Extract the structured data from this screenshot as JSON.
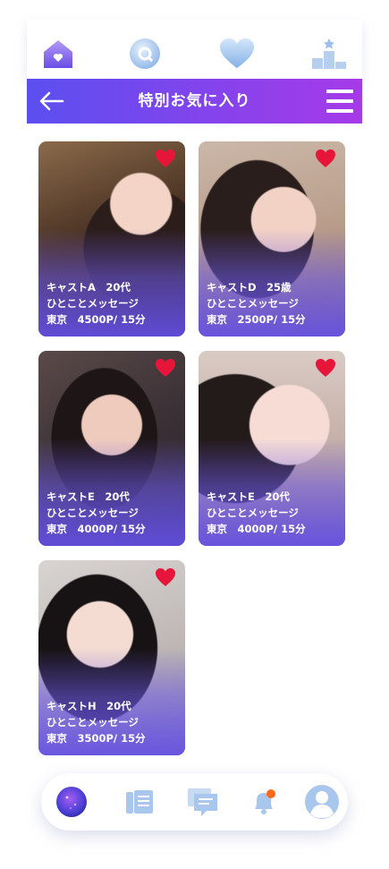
{
  "topnav": {
    "items": [
      {
        "icon": "home-icon"
      },
      {
        "icon": "search-icon"
      },
      {
        "icon": "heart-icon"
      },
      {
        "icon": "ranking-icon"
      }
    ]
  },
  "header": {
    "title": "特別お気に入り",
    "back_icon": "arrow-left-icon",
    "menu_icon": "hamburger-menu-icon"
  },
  "cards": [
    {
      "name_age": "キャストA　20代",
      "message": "ひとことメッセージ",
      "location_price": "東京　4500P/ 15分"
    },
    {
      "name_age": "キャストD　25歳",
      "message": "ひとことメッセージ",
      "location_price": "東京　2500P/ 15分"
    },
    {
      "name_age": "キャストE　20代",
      "message": "ひとことメッセージ",
      "location_price": "東京　4000P/ 15分"
    },
    {
      "name_age": "キャストE　20代",
      "message": "ひとことメッセージ",
      "location_price": "東京　4000P/ 15分"
    },
    {
      "name_age": "キャストH　20代",
      "message": "ひとことメッセージ",
      "location_price": "東京　3500P/ 15分"
    }
  ],
  "bottombar": {
    "items": [
      {
        "icon": "profile-planet-icon"
      },
      {
        "icon": "book-icon"
      },
      {
        "icon": "chat-icon"
      },
      {
        "icon": "bell-icon",
        "badge": true
      },
      {
        "icon": "user-icon"
      }
    ]
  },
  "colors": {
    "header_start": "#5b4ff0",
    "header_end": "#a63ae8",
    "heart": "#e8153b",
    "icon_light": "#a9c7ec"
  }
}
